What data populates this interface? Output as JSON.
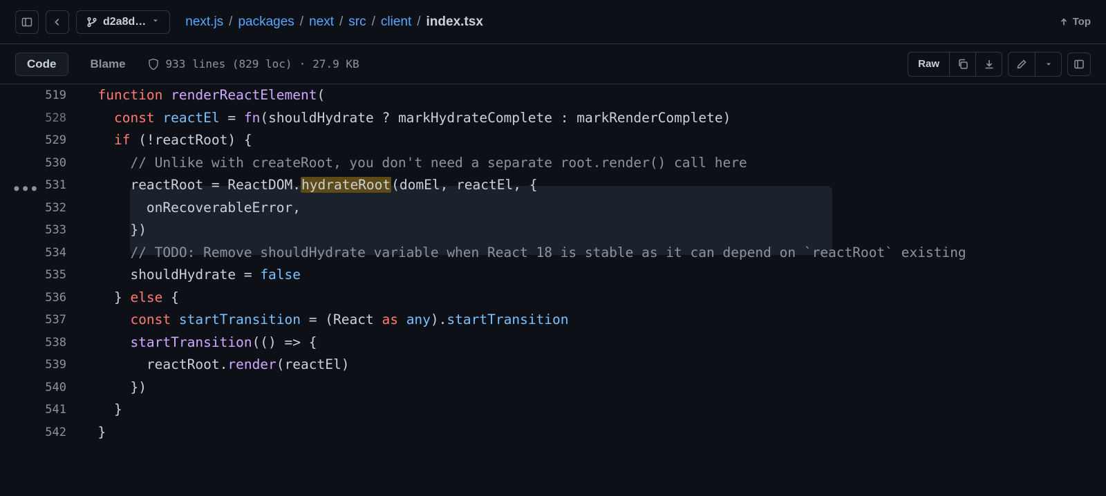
{
  "topbar": {
    "branch": "d2a8d…",
    "top_label": "Top",
    "breadcrumb": {
      "parts": [
        "next.js",
        "packages",
        "next",
        "src",
        "client"
      ],
      "current": "index.tsx"
    }
  },
  "toolbar": {
    "tabs": {
      "code": "Code",
      "blame": "Blame"
    },
    "fileinfo": {
      "lines": "933 lines (829 loc)",
      "dot": "·",
      "size": "27.9 KB"
    },
    "raw": "Raw"
  },
  "lines": {
    "l519": {
      "num": "519"
    },
    "l528": {
      "num": "528"
    },
    "l529": {
      "num": "529"
    },
    "l530": {
      "num": "530",
      "comment": "// Unlike with createRoot, you don't need a separate root.render() call here"
    },
    "l531": {
      "num": "531",
      "before": "reactRoot = ReactDOM.",
      "hl": "hydrateRoot",
      "after": "(domEl, reactEl, {"
    },
    "l532": {
      "num": "532",
      "text": "onRecoverableError,"
    },
    "l533": {
      "num": "533",
      "text": "})"
    },
    "l534": {
      "num": "534",
      "comment": "// TODO: Remove shouldHydrate variable when React 18 is stable as it can depend on `reactRoot` existing"
    },
    "l535": {
      "num": "535"
    },
    "l536": {
      "num": "536"
    },
    "l537": {
      "num": "537"
    },
    "l538": {
      "num": "538"
    },
    "l539": {
      "num": "539"
    },
    "l540": {
      "num": "540",
      "text": "})"
    },
    "l541": {
      "num": "541",
      "text": "}"
    },
    "l542": {
      "num": "542",
      "text": "}"
    }
  },
  "tok": {
    "function": "function",
    "renderReactElement": "renderReactElement",
    "lparen": "(",
    "rparen": ")",
    "const": "const",
    "reactEl": "reactEl",
    "eq": " = ",
    "fn_": "fn",
    "shouldHydrate": "shouldHydrate",
    "q": " ? ",
    "markHydrateComplete": "markHydrateComplete",
    "colon": " : ",
    "markRenderComplete": "markRenderComplete",
    "if": "if",
    "bang": " (!",
    "reactRoot": "reactRoot",
    "rp_brace": ") {",
    "else": "else",
    "brace_else": "} ",
    "brace_open": " {",
    "startTransition": "startTransition",
    "React": "React",
    "as": "as",
    "any": "any",
    "dot": ".",
    "arrow": "(() => {",
    "render": "render",
    "false": "false",
    "eq2": " = "
  }
}
